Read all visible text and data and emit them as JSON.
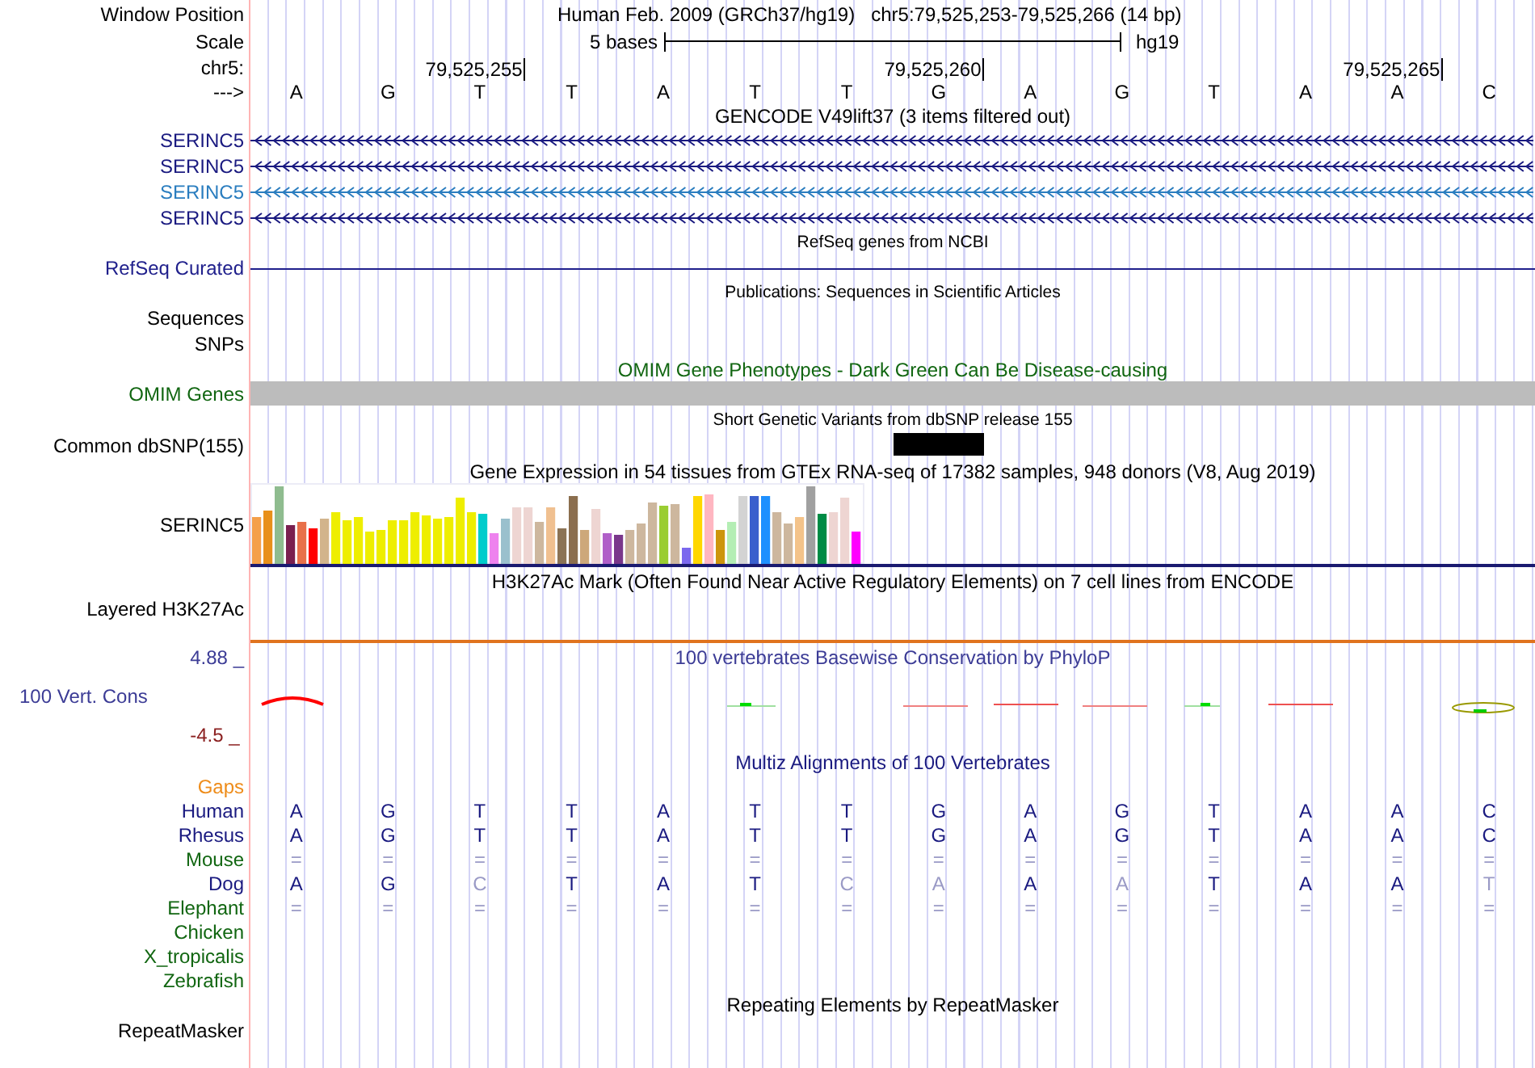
{
  "header": {
    "window_position": {
      "label": "Window Position",
      "assembly": "Human Feb. 2009 (GRCh37/hg19)",
      "position": "chr5:79,525,253-79,525,266 (14 bp)"
    },
    "scale": {
      "label": "Scale",
      "span": "5 bases",
      "assembly": "hg19"
    },
    "ruler": {
      "label": "chr5:",
      "ticks": [
        "79,525,255",
        "79,525,260",
        "79,525,265"
      ]
    },
    "sequence": {
      "label": "--->",
      "bases": [
        "A",
        "G",
        "T",
        "T",
        "A",
        "T",
        "T",
        "G",
        "A",
        "G",
        "T",
        "A",
        "A",
        "C"
      ]
    }
  },
  "tracks": [
    {
      "kind": "gencode",
      "title": "GENCODE V49lift37 (3 items filtered out)",
      "items": [
        {
          "label": "SERINC5",
          "color": "#1a1a80"
        },
        {
          "label": "SERINC5",
          "color": "#1a1a80"
        },
        {
          "label": "SERINC5",
          "color": "#2a7dbf"
        },
        {
          "label": "SERINC5",
          "color": "#1a1a80"
        }
      ]
    },
    {
      "kind": "refseq",
      "title": "RefSeq genes from NCBI",
      "label": "RefSeq Curated",
      "color": "#20208c"
    },
    {
      "kind": "publications",
      "title": "Publications: Sequences in Scientific Articles",
      "labels": [
        "Sequences",
        "SNPs"
      ]
    },
    {
      "kind": "omim",
      "title": "OMIM Gene Phenotypes - Dark Green Can Be Disease-causing",
      "label": "OMIM Genes",
      "color": "#116611"
    },
    {
      "kind": "dbsnp",
      "title": "Short Genetic Variants from dbSNP release 155",
      "label": "Common dbSNP(155)"
    },
    {
      "kind": "expression",
      "title": "Gene Expression in 54 tissues from GTEx RNA-seq of 17382 samples, 948 donors (V8, Aug 2019)",
      "label": "SERINC5"
    },
    {
      "kind": "h3k27ac",
      "title": "H3K27Ac Mark (Often Found Near Active Regulatory Elements) on 7 cell lines from ENCODE",
      "label": "Layered H3K27Ac"
    },
    {
      "kind": "conservation",
      "title": "100 vertebrates Basewise Conservation by PhyloP",
      "label": "100 Vert. Cons",
      "max": "4.88 _",
      "min": "-4.5 _"
    },
    {
      "kind": "multiz",
      "title": "Multiz Alignments of 100 Vertebrates",
      "rows": [
        {
          "label": "Gaps",
          "color": "#ee8c1a",
          "bases": []
        },
        {
          "label": "Human",
          "color": "#1a1a80",
          "bases": [
            {
              "base": "A",
              "faint": false
            },
            {
              "base": "G",
              "faint": false
            },
            {
              "base": "T",
              "faint": false
            },
            {
              "base": "T",
              "faint": false
            },
            {
              "base": "A",
              "faint": false
            },
            {
              "base": "T",
              "faint": false
            },
            {
              "base": "T",
              "faint": false
            },
            {
              "base": "G",
              "faint": false
            },
            {
              "base": "A",
              "faint": false
            },
            {
              "base": "G",
              "faint": false
            },
            {
              "base": "T",
              "faint": false
            },
            {
              "base": "A",
              "faint": false
            },
            {
              "base": "A",
              "faint": false
            },
            {
              "base": "C",
              "faint": false
            }
          ]
        },
        {
          "label": "Rhesus",
          "color": "#1a1a80",
          "bases": [
            {
              "base": "A",
              "faint": false
            },
            {
              "base": "G",
              "faint": false
            },
            {
              "base": "T",
              "faint": false
            },
            {
              "base": "T",
              "faint": false
            },
            {
              "base": "A",
              "faint": false
            },
            {
              "base": "T",
              "faint": false
            },
            {
              "base": "T",
              "faint": false
            },
            {
              "base": "G",
              "faint": false
            },
            {
              "base": "A",
              "faint": false
            },
            {
              "base": "G",
              "faint": false
            },
            {
              "base": "T",
              "faint": false
            },
            {
              "base": "A",
              "faint": false
            },
            {
              "base": "A",
              "faint": false
            },
            {
              "base": "C",
              "faint": false
            }
          ]
        },
        {
          "label": "Mouse",
          "color": "#116611",
          "bases": [
            {
              "base": "=",
              "faint": true
            },
            {
              "base": "=",
              "faint": true
            },
            {
              "base": "=",
              "faint": true
            },
            {
              "base": "=",
              "faint": true
            },
            {
              "base": "=",
              "faint": true
            },
            {
              "base": "=",
              "faint": true
            },
            {
              "base": "=",
              "faint": true
            },
            {
              "base": "=",
              "faint": true
            },
            {
              "base": "=",
              "faint": true
            },
            {
              "base": "=",
              "faint": true
            },
            {
              "base": "=",
              "faint": true
            },
            {
              "base": "=",
              "faint": true
            },
            {
              "base": "=",
              "faint": true
            },
            {
              "base": "=",
              "faint": true
            }
          ]
        },
        {
          "label": "Dog",
          "color": "#1a1a80",
          "bases": [
            {
              "base": "A",
              "faint": false
            },
            {
              "base": "G",
              "faint": false
            },
            {
              "base": "C",
              "faint": true
            },
            {
              "base": "T",
              "faint": false
            },
            {
              "base": "A",
              "faint": false
            },
            {
              "base": "T",
              "faint": false
            },
            {
              "base": "C",
              "faint": true
            },
            {
              "base": "A",
              "faint": true
            },
            {
              "base": "A",
              "faint": false
            },
            {
              "base": "A",
              "faint": true
            },
            {
              "base": "T",
              "faint": false
            },
            {
              "base": "A",
              "faint": false
            },
            {
              "base": "A",
              "faint": false
            },
            {
              "base": "T",
              "faint": true
            }
          ]
        },
        {
          "label": "Elephant",
          "color": "#116611",
          "bases": [
            {
              "base": "=",
              "faint": true
            },
            {
              "base": "=",
              "faint": true
            },
            {
              "base": "=",
              "faint": true
            },
            {
              "base": "=",
              "faint": true
            },
            {
              "base": "=",
              "faint": true
            },
            {
              "base": "=",
              "faint": true
            },
            {
              "base": "=",
              "faint": true
            },
            {
              "base": "=",
              "faint": true
            },
            {
              "base": "=",
              "faint": true
            },
            {
              "base": "=",
              "faint": true
            },
            {
              "base": "=",
              "faint": true
            },
            {
              "base": "=",
              "faint": true
            },
            {
              "base": "=",
              "faint": true
            },
            {
              "base": "=",
              "faint": true
            }
          ]
        },
        {
          "label": "Chicken",
          "color": "#116611",
          "bases": []
        },
        {
          "label": "X_tropicalis",
          "color": "#116611",
          "bases": []
        },
        {
          "label": "Zebrafish",
          "color": "#116611",
          "bases": []
        }
      ]
    },
    {
      "kind": "repeatmasker",
      "title": "Repeating Elements by RepeatMasker",
      "label": "RepeatMasker"
    }
  ]
}
